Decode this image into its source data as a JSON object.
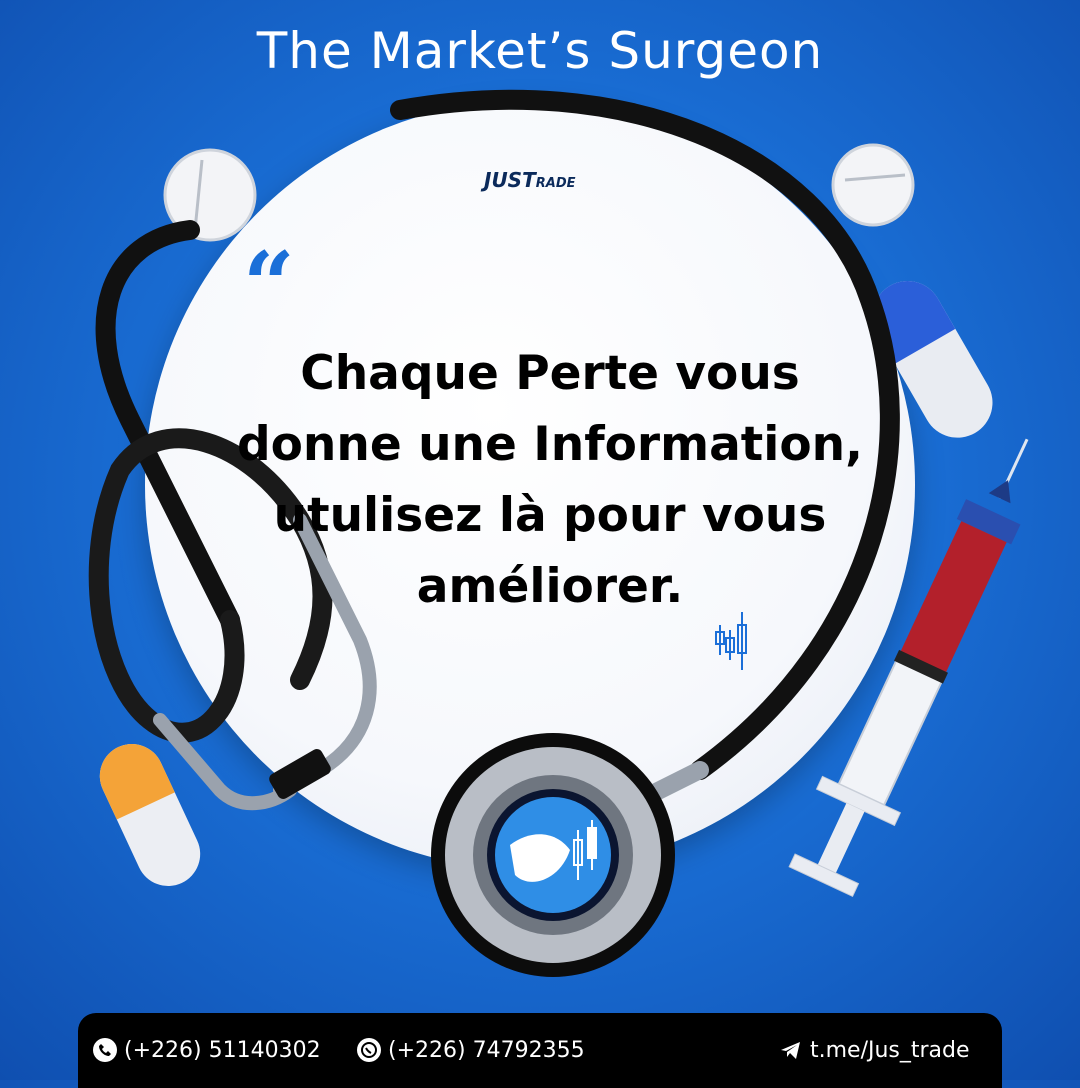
{
  "header": {
    "title": "The Market’s Surgeon"
  },
  "brand": {
    "logo_text_a": "JUS",
    "logo_text_b": "T",
    "logo_text_c": "RADE"
  },
  "quote": {
    "mark": "“",
    "lines": [
      "Chaque Perte vous",
      "donne une Information,",
      "utulisez là pour vous",
      "améliorer."
    ]
  },
  "footer": {
    "phone": "(+226) 51140302",
    "whatsapp": "(+226) 74792355",
    "telegram": "t.me/Jus_trade"
  },
  "colors": {
    "background": "#1a6fd6",
    "accent": "#1b6fd8",
    "footer_bg": "#000000"
  },
  "icons": [
    "phone-icon",
    "whatsapp-icon",
    "telegram-icon",
    "stethoscope-icon",
    "syringe-icon",
    "pill-icon",
    "candlestick-icon"
  ]
}
